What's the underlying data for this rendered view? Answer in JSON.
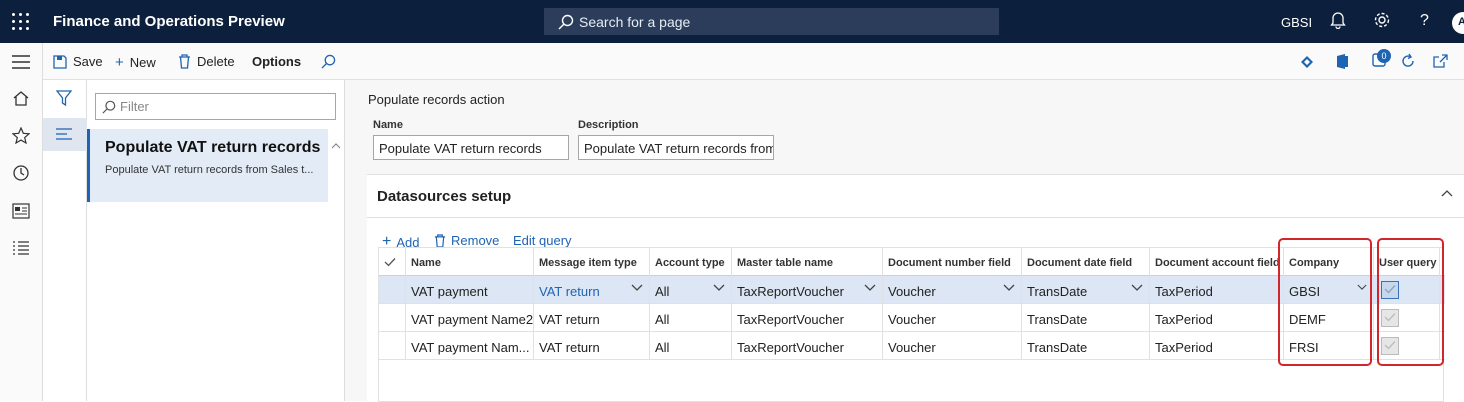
{
  "app": {
    "title": "Finance and Operations Preview",
    "search_placeholder": "Search for a page",
    "company": "GBSI",
    "avatar_initial": "A"
  },
  "toolbar": {
    "save": "Save",
    "new": "New",
    "delete": "Delete",
    "options": "Options",
    "notification_count": "0"
  },
  "filter": {
    "placeholder": "Filter"
  },
  "list": {
    "items": [
      {
        "title": "Populate VAT return records",
        "subtitle": "Populate VAT return records from Sales t..."
      }
    ]
  },
  "form": {
    "caption": "Populate records action",
    "name_label": "Name",
    "name_value": "Populate VAT return records",
    "description_label": "Description",
    "description_value": "Populate VAT return records from"
  },
  "datasources": {
    "title": "Datasources setup",
    "add": "Add",
    "remove": "Remove",
    "edit_query": "Edit query",
    "columns": [
      "Name",
      "Message item type",
      "Account type",
      "Master table name",
      "Document number field",
      "Document date field",
      "Document account field",
      "Company",
      "User query"
    ],
    "rows": [
      {
        "name": "VAT payment",
        "message_item_type": "VAT return",
        "account_type": "All",
        "master_table": "TaxReportVoucher",
        "doc_number_field": "Voucher",
        "doc_date_field": "TransDate",
        "doc_account_field": "TaxPeriod",
        "company": "GBSI",
        "user_query": true
      },
      {
        "name": "VAT payment Name2",
        "message_item_type": "VAT return",
        "account_type": "All",
        "master_table": "TaxReportVoucher",
        "doc_number_field": "Voucher",
        "doc_date_field": "TransDate",
        "doc_account_field": "TaxPeriod",
        "company": "DEMF",
        "user_query": true
      },
      {
        "name": "VAT payment Nam...",
        "message_item_type": "VAT return",
        "account_type": "All",
        "master_table": "TaxReportVoucher",
        "doc_number_field": "Voucher",
        "doc_date_field": "TransDate",
        "doc_account_field": "TaxPeriod",
        "company": "FRSI",
        "user_query": true
      }
    ]
  },
  "colors": {
    "nav_bg": "#0c1f3c",
    "accent": "#1f63b3",
    "highlight": "#d1262b",
    "selected_row": "#dce6f4"
  }
}
